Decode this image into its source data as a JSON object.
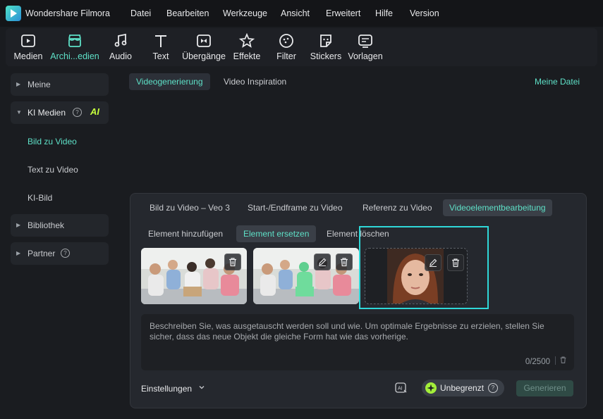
{
  "app": {
    "name": "Wondershare Filmora",
    "menu": [
      "Datei",
      "Bearbeiten",
      "Werkzeuge",
      "Ansicht",
      "Erweitert",
      "Hilfe",
      "Version"
    ]
  },
  "toolbar": {
    "items": [
      {
        "label": "Medien",
        "icon": "media-icon"
      },
      {
        "label": "Archi...edien",
        "icon": "stock-media-icon",
        "active": true
      },
      {
        "label": "Audio",
        "icon": "music-note-icon"
      },
      {
        "label": "Text",
        "icon": "text-t-icon"
      },
      {
        "label": "Übergänge",
        "icon": "transitions-icon"
      },
      {
        "label": "Effekte",
        "icon": "effects-star-icon"
      },
      {
        "label": "Filter",
        "icon": "filter-icon"
      },
      {
        "label": "Stickers",
        "icon": "sticker-icon"
      },
      {
        "label": "Vorlagen",
        "icon": "templates-icon"
      }
    ],
    "accent": "#5ee0c7"
  },
  "sidebar": {
    "meine": "Meine",
    "ki_medien": "KI Medien",
    "ai_badge": "AI",
    "sub": [
      "Bild zu Video",
      "Text zu Video",
      "KI-Bild"
    ],
    "bibliothek": "Bibliothek",
    "partner": "Partner",
    "help": "?"
  },
  "main": {
    "tabs": [
      "Videogenerierung",
      "Video Inspiration"
    ],
    "my_file": "Meine Datei"
  },
  "panel": {
    "tabs": [
      "Bild zu Video – Veo 3",
      "Start-/Endframe zu Video",
      "Referenz zu Video",
      "Videoelementbearbeitung"
    ],
    "subtabs": [
      "Element hinzufügen",
      "Element ersetzen",
      "Element löschen"
    ],
    "prompt": "Beschreiben Sie, was ausgetauscht werden soll und wie. Um optimale Ergebnisse zu erzielen, stellen Sie sicher, dass das neue Objekt die gleiche Form hat wie das vorherige.",
    "counter": "0/2500",
    "settings": "Einstellungen",
    "unlimited": "Unbegrenzt",
    "help": "?",
    "generate": "Generieren"
  }
}
